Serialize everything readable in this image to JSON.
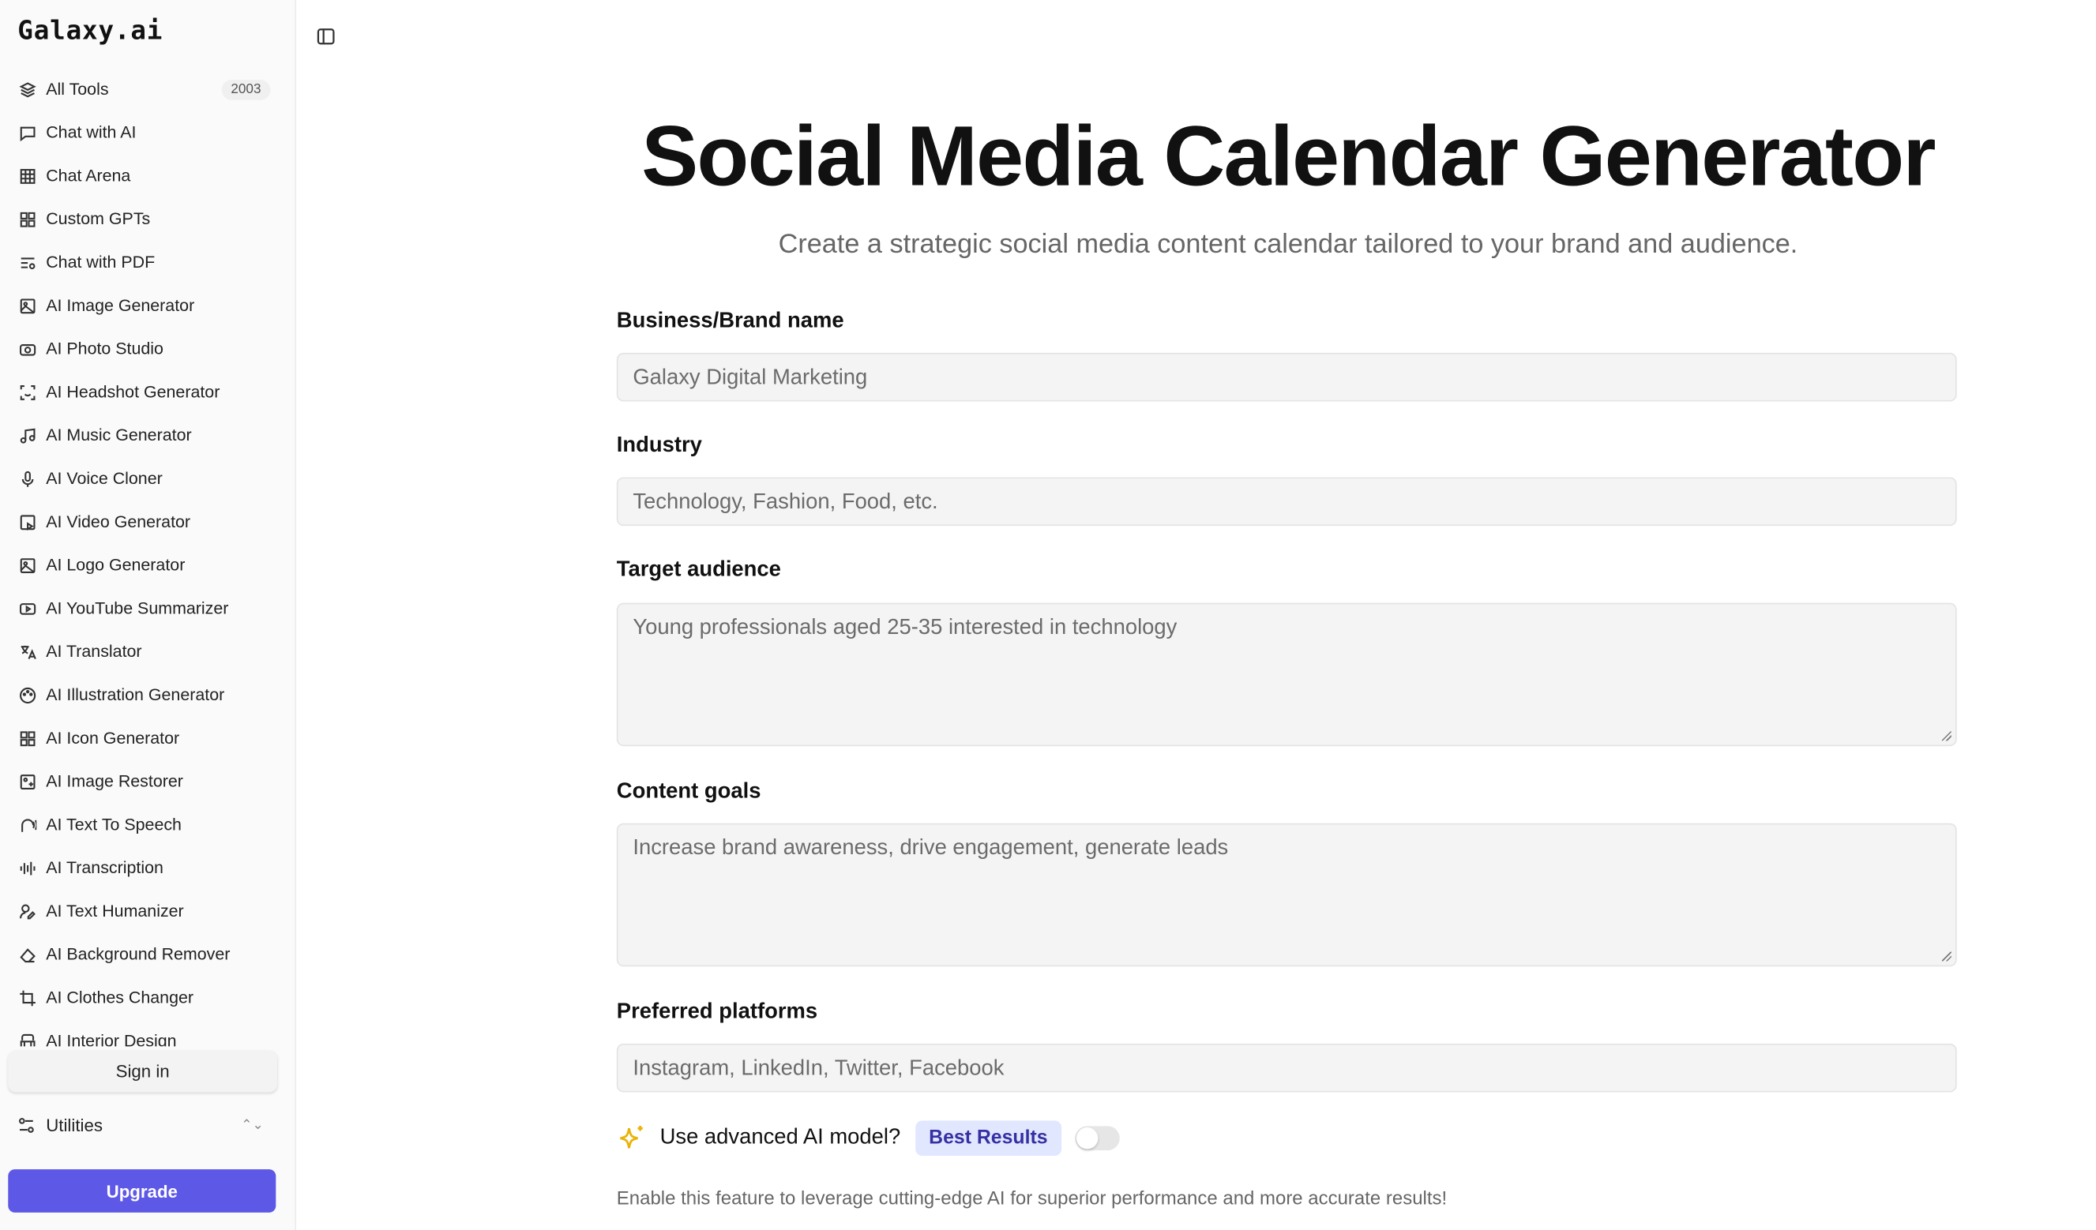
{
  "sidebar": {
    "logo": "Galaxy.ai",
    "items": [
      {
        "label": "All Tools",
        "icon": "layers-icon",
        "badge": "2003"
      },
      {
        "label": "Chat with AI",
        "icon": "chat-bubble-icon"
      },
      {
        "label": "Chat Arena",
        "icon": "grid-table-icon"
      },
      {
        "label": "Custom GPTs",
        "icon": "grid-squares-icon"
      },
      {
        "label": "Chat with PDF",
        "icon": "text-search-icon"
      },
      {
        "label": "AI Image Generator",
        "icon": "image-icon"
      },
      {
        "label": "AI Photo Studio",
        "icon": "camera-icon"
      },
      {
        "label": "AI Headshot Generator",
        "icon": "face-scan-icon"
      },
      {
        "label": "AI Music Generator",
        "icon": "music-note-icon"
      },
      {
        "label": "AI Voice Cloner",
        "icon": "microphone-icon"
      },
      {
        "label": "AI Video Generator",
        "icon": "video-image-icon"
      },
      {
        "label": "AI Logo Generator",
        "icon": "image-icon"
      },
      {
        "label": "AI YouTube Summarizer",
        "icon": "youtube-icon"
      },
      {
        "label": "AI Translator",
        "icon": "translate-icon"
      },
      {
        "label": "AI Illustration Generator",
        "icon": "palette-icon"
      },
      {
        "label": "AI Icon Generator",
        "icon": "grid-squares-icon"
      },
      {
        "label": "AI Image Restorer",
        "icon": "image-restore-icon"
      },
      {
        "label": "AI Text To Speech",
        "icon": "speech-icon"
      },
      {
        "label": "AI Transcription",
        "icon": "audio-wave-icon"
      },
      {
        "label": "AI Text Humanizer",
        "icon": "user-pen-icon"
      },
      {
        "label": "AI Background Remover",
        "icon": "eraser-icon"
      },
      {
        "label": "AI Clothes Changer",
        "icon": "crop-icon"
      },
      {
        "label": "AI Interior Design",
        "icon": "armchair-icon"
      }
    ],
    "sign_in": "Sign in",
    "utilities": "Utilities",
    "upgrade": "Upgrade"
  },
  "main": {
    "title": "Social Media Calendar Generator",
    "subtitle": "Create a strategic social media content calendar tailored to your brand and audience.",
    "fields": [
      {
        "label": "Business/Brand name",
        "placeholder": "Galaxy Digital Marketing"
      },
      {
        "label": "Industry",
        "placeholder": "Technology, Fashion, Food, etc."
      },
      {
        "label": "Target audience",
        "placeholder": "Young professionals aged 25-35 interested in technology"
      },
      {
        "label": "Content goals",
        "placeholder": "Increase brand awareness, drive engagement, generate leads"
      },
      {
        "label": "Preferred platforms",
        "placeholder": "Instagram, LinkedIn, Twitter, Facebook"
      }
    ],
    "advanced": {
      "label": "Use advanced AI model?",
      "badge": "Best Results",
      "enabled": false,
      "hint": "Enable this feature to leverage cutting-edge AI for superior performance and more accurate results!"
    }
  },
  "colors": {
    "accent": "#5e58e6",
    "badge_bg": "#e0e7ff",
    "badge_text": "#3730a3",
    "sparkle": "#eab308"
  }
}
